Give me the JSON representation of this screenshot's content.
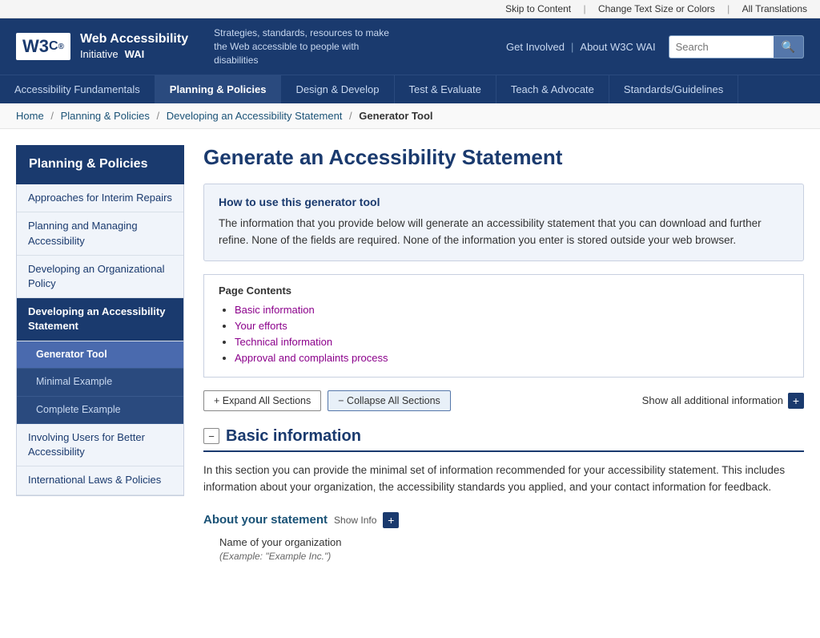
{
  "utility": {
    "skip_label": "Skip to Content",
    "text_size_label": "Change Text Size or Colors",
    "translations_label": "All Translations"
  },
  "header": {
    "w3c_logo": "W3C",
    "w3c_reg": "®",
    "wai_line1": "Web Accessibility",
    "wai_line2a": "Initiative",
    "wai_line2b": "WAI",
    "tagline": "Strategies, standards, resources to make the Web accessible to people with disabilities",
    "nav_link1": "Get Involved",
    "nav_link2": "About W3C WAI",
    "search_placeholder": "Search"
  },
  "main_nav": {
    "items": [
      {
        "label": "Accessibility Fundamentals",
        "active": false
      },
      {
        "label": "Planning & Policies",
        "active": true
      },
      {
        "label": "Design & Develop",
        "active": false
      },
      {
        "label": "Test & Evaluate",
        "active": false
      },
      {
        "label": "Teach & Advocate",
        "active": false
      },
      {
        "label": "Standards/Guidelines",
        "active": false
      }
    ]
  },
  "breadcrumb": {
    "items": [
      {
        "label": "Home",
        "href": "#"
      },
      {
        "label": "Planning & Policies",
        "href": "#"
      },
      {
        "label": "Developing an Accessibility Statement",
        "href": "#"
      },
      {
        "label": "Generator Tool",
        "current": true
      }
    ]
  },
  "sidebar": {
    "title": "Planning & Policies",
    "nav_items": [
      {
        "label": "Approaches for Interim Repairs",
        "active": false
      },
      {
        "label": "Planning and Managing Accessibility",
        "active": false
      },
      {
        "label": "Developing an Organizational Policy",
        "active": false
      },
      {
        "label": "Developing an Accessibility Statement",
        "active": true,
        "sub_items": [
          {
            "label": "Generator Tool",
            "active": true
          },
          {
            "label": "Minimal Example",
            "active": false
          },
          {
            "label": "Complete Example",
            "active": false
          }
        ]
      },
      {
        "label": "Involving Users for Better Accessibility",
        "active": false
      },
      {
        "label": "International Laws & Policies",
        "active": false
      }
    ]
  },
  "content": {
    "page_title": "Generate an Accessibility Statement",
    "info_box": {
      "title": "How to use this generator tool",
      "body": "The information that you provide below will generate an accessibility statement that you can download and further refine. None of the fields are required. None of the information you enter is stored outside your web browser."
    },
    "page_contents": {
      "title": "Page Contents",
      "items": [
        {
          "label": "Basic information",
          "href": "#"
        },
        {
          "label": "Your efforts",
          "href": "#"
        },
        {
          "label": "Technical information",
          "href": "#"
        },
        {
          "label": "Approval and complaints process",
          "href": "#"
        }
      ]
    },
    "controls": {
      "expand_label": "+ Expand All Sections",
      "collapse_label": "− Collapse All Sections",
      "show_additional_label": "Show all additional information",
      "plus_icon": "+"
    },
    "basic_section": {
      "toggle": "−",
      "title": "Basic information",
      "description": "In this section you can provide the minimal set of information recommended for your accessibility statement. This includes information about your organization, the accessibility standards you applied, and your contact information for feedback.",
      "about_statement": {
        "title": "About your statement",
        "show_info_label": "Show Info",
        "plus_icon": "+",
        "org_name_label": "Name of your organization",
        "org_name_example": "(Example: \"Example Inc.\")"
      }
    }
  }
}
